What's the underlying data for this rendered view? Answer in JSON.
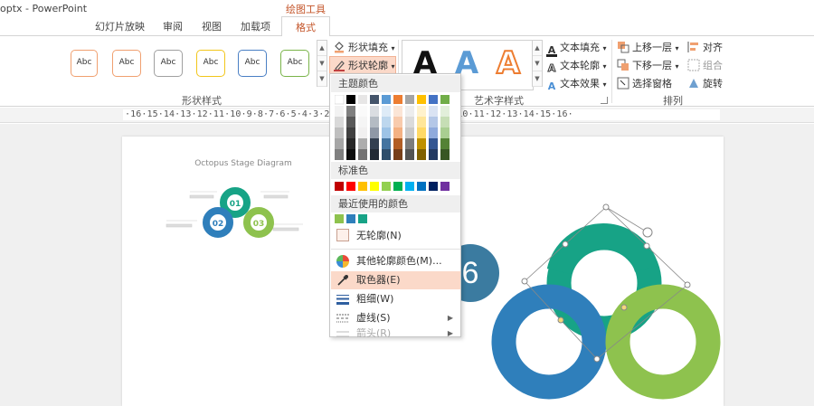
{
  "window": {
    "title": "optx - PowerPoint",
    "tool_tab": "绘图工具"
  },
  "tabs": [
    {
      "label": "幻灯片放映",
      "active": false
    },
    {
      "label": "审阅",
      "active": false
    },
    {
      "label": "视图",
      "active": false
    },
    {
      "label": "加载项",
      "active": false
    },
    {
      "label": "格式",
      "active": true
    }
  ],
  "ribbon": {
    "shape_styles": {
      "label": "形状样式",
      "items": [
        {
          "text": "Abc",
          "color": "#f0a070"
        },
        {
          "text": "Abc",
          "color": "#a0a0a0"
        },
        {
          "text": "Abc",
          "color": "#f2c61b"
        },
        {
          "text": "Abc",
          "color": "#4a7fc4"
        },
        {
          "text": "Abc",
          "color": "#7ab44a"
        }
      ],
      "shape_fill": "形状填充",
      "shape_outline": "形状轮廓"
    },
    "wordart": {
      "label": "艺术字样式",
      "samples": [
        {
          "text": "A",
          "color": "#111111"
        },
        {
          "text": "A",
          "color": "#5b9bd5"
        },
        {
          "text": "A",
          "color": "#ed7d31"
        }
      ],
      "text_fill": "文本填充",
      "text_outline": "文本轮廓",
      "text_effects": "文本效果"
    },
    "arrange": {
      "label": "排列",
      "bring_forward": "上移一层",
      "send_backward": "下移一层",
      "selection_pane": "选择窗格",
      "align": "对齐",
      "group": "组合",
      "rotate": "旋转"
    }
  },
  "ruler": {
    "text": "·16·15·14·13·12·11·10·9·8·7·6·5·4·3·2·1·0·1·2·3·4·5·6·7·8·9·10·11·12·13·14·15·16·"
  },
  "slide_thumbnail": {
    "title": "Octopus Stage Diagram",
    "circles": [
      {
        "label": "01",
        "color": "#17a386"
      },
      {
        "label": "02",
        "color": "#2f7fbb"
      },
      {
        "label": "03",
        "color": "#8ec24e"
      }
    ]
  },
  "dropdown": {
    "theme_colors_label": "主题颜色",
    "standard_colors_label": "标准色",
    "recent_colors_label": "最近使用的颜色",
    "theme_top_row": [
      "#ffffff",
      "#000000",
      "#e7e6e6",
      "#44546a",
      "#5b9bd5",
      "#ed7d31",
      "#a5a5a5",
      "#ffc000",
      "#4472c4",
      "#70ad47"
    ],
    "standard_colors": [
      "#c00000",
      "#ff0000",
      "#ffc000",
      "#ffff00",
      "#92d050",
      "#00b050",
      "#00b0f0",
      "#0070c0",
      "#002060",
      "#7030a0"
    ],
    "recent_colors": [
      "#8ec24e",
      "#2f7fbb",
      "#17a386"
    ],
    "items": {
      "no_outline": "无轮廓(N)",
      "more_colors": "其他轮廓颜色(M)...",
      "eyedropper": "取色器(E)",
      "weight": "粗细(W)",
      "dashes": "虚线(S)",
      "arrows": "箭头(R)"
    }
  },
  "step_badge": "6",
  "colors": {
    "teal": "#17a386",
    "blue": "#2f7fbb",
    "green": "#8ec24e",
    "accent": "#c4552a",
    "highlight": "#fbd9c9"
  }
}
